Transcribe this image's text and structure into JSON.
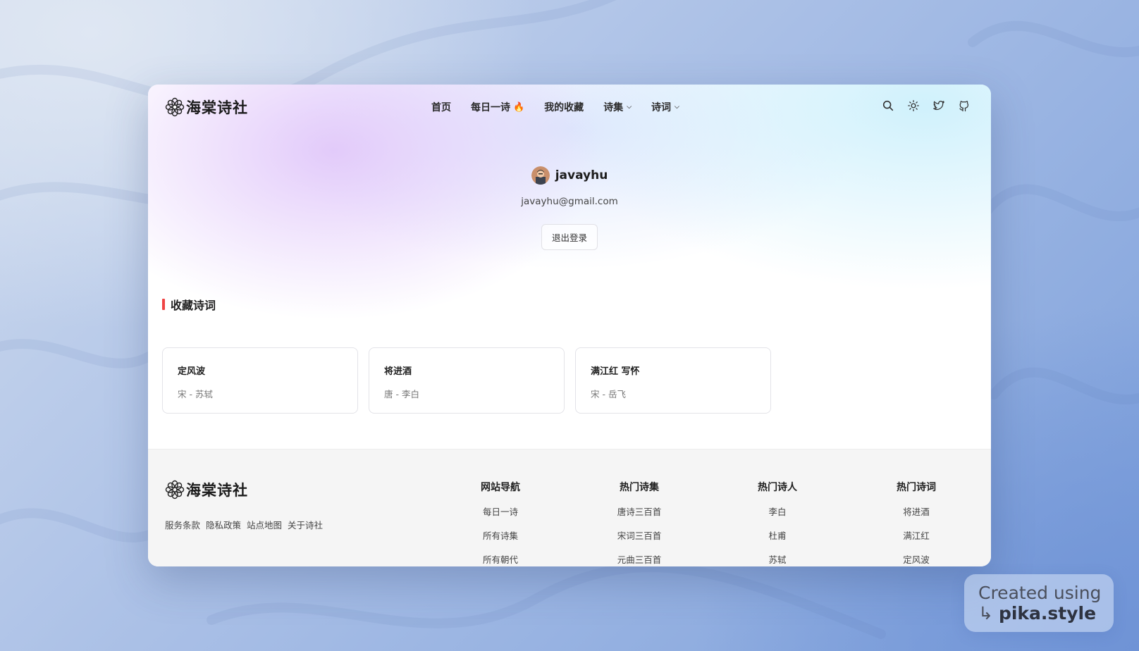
{
  "brand": {
    "name": "海棠诗社"
  },
  "nav": {
    "items": [
      {
        "label": "首页"
      },
      {
        "label": "每日一诗",
        "badge": "🔥"
      },
      {
        "label": "我的收藏"
      },
      {
        "label": "诗集",
        "dropdown": true
      },
      {
        "label": "诗词",
        "dropdown": true
      }
    ]
  },
  "tools": [
    "search-icon",
    "sun-icon",
    "twitter-icon",
    "github-icon"
  ],
  "profile": {
    "username": "javayhu",
    "email": "javayhu@gmail.com",
    "logout_label": "退出登录"
  },
  "favorites": {
    "title": "收藏诗词",
    "cards": [
      {
        "title": "定风波",
        "meta": "宋 - 苏轼"
      },
      {
        "title": "将进酒",
        "meta": "唐 - 李白"
      },
      {
        "title": "满江红 写怀",
        "meta": "宋 - 岳飞"
      }
    ]
  },
  "footer": {
    "brand_name": "海棠诗社",
    "links": [
      "服务条款",
      "隐私政策",
      "站点地图",
      "关于诗社"
    ],
    "columns": [
      {
        "title": "网站导航",
        "items": [
          "每日一诗",
          "所有诗集",
          "所有朝代"
        ]
      },
      {
        "title": "热门诗集",
        "items": [
          "唐诗三百首",
          "宋词三百首",
          "元曲三百首"
        ]
      },
      {
        "title": "热门诗人",
        "items": [
          "李白",
          "杜甫",
          "苏轼"
        ]
      },
      {
        "title": "热门诗词",
        "items": [
          "将进酒",
          "满江红",
          "定风波"
        ]
      }
    ]
  },
  "watermark": {
    "line1": "Created using",
    "line2": "pika.style",
    "arrow": "↳"
  },
  "colors": {
    "accent_bar": "#ef4444",
    "footer_bg": "#f5f5f5"
  }
}
